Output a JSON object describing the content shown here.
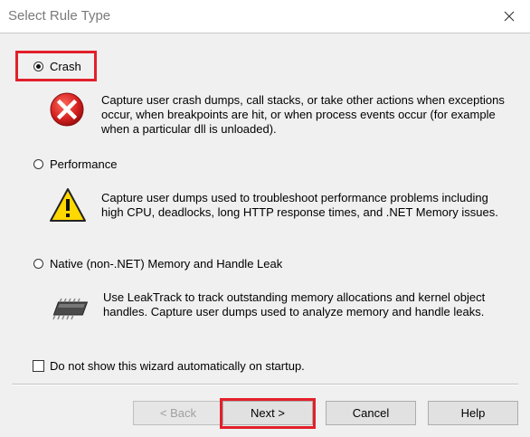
{
  "window": {
    "title": "Select Rule Type"
  },
  "options": [
    {
      "label": "Crash",
      "selected": true,
      "description": [
        "Capture user crash dumps, call stacks, or take other actions when exceptions",
        "occur, when breakpoints are hit, or when process events occur (for example",
        "when a particular dll is unloaded)."
      ],
      "icon": "error-icon"
    },
    {
      "label": "Performance",
      "selected": false,
      "description": [
        "Capture user dumps used to troubleshoot performance problems including",
        "high CPU, deadlocks, long HTTP response times, and .NET Memory issues."
      ],
      "icon": "warning-icon"
    },
    {
      "label": "Native (non-.NET) Memory and Handle Leak",
      "selected": false,
      "description": [
        "Use LeakTrack to track outstanding memory allocations and kernel object",
        "handles. Capture user dumps used to analyze memory and handle leaks."
      ],
      "icon": "memory-chip-icon"
    }
  ],
  "checkbox": {
    "label": "Do not show this wizard automatically on startup.",
    "checked": false
  },
  "buttons": {
    "back": "< Back",
    "next": "Next >",
    "cancel": "Cancel",
    "help": "Help"
  },
  "colors": {
    "highlight": "#e2202a",
    "error_red": "#d21f1f",
    "warning_yellow": "#ffd800"
  }
}
